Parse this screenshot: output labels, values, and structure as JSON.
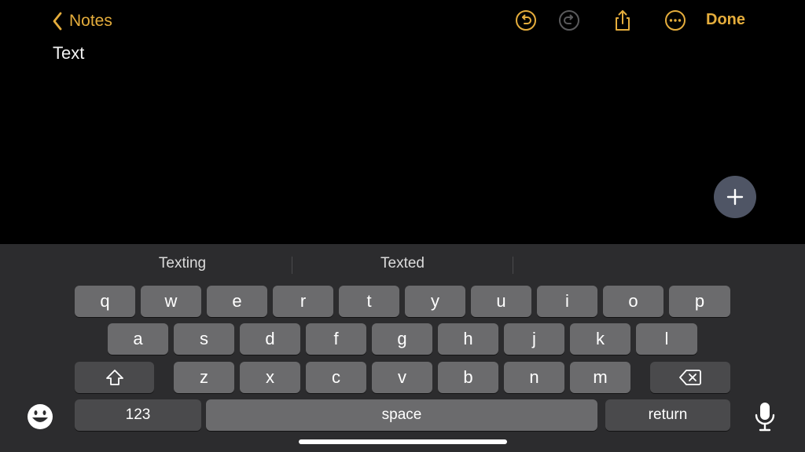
{
  "toolbar": {
    "back_label": "Notes",
    "done_label": "Done",
    "icons": [
      "chevron-left-icon",
      "undo-icon",
      "redo-icon",
      "share-icon",
      "more-icon"
    ],
    "accent_color": "#e5ad3c"
  },
  "note": {
    "text": "Text"
  },
  "fab": {
    "icon": "plus-icon"
  },
  "keyboard": {
    "suggestions": [
      "Texting",
      "Texted",
      ""
    ],
    "row1": [
      "q",
      "w",
      "e",
      "r",
      "t",
      "y",
      "u",
      "i",
      "o",
      "p"
    ],
    "row2": [
      "a",
      "s",
      "d",
      "f",
      "g",
      "h",
      "j",
      "k",
      "l"
    ],
    "row3": [
      "z",
      "x",
      "c",
      "v",
      "b",
      "n",
      "m"
    ],
    "numbers_label": "123",
    "space_label": "space",
    "return_label": "return",
    "icons": [
      "shift-icon",
      "delete-icon",
      "emoji-icon",
      "microphone-icon"
    ]
  }
}
